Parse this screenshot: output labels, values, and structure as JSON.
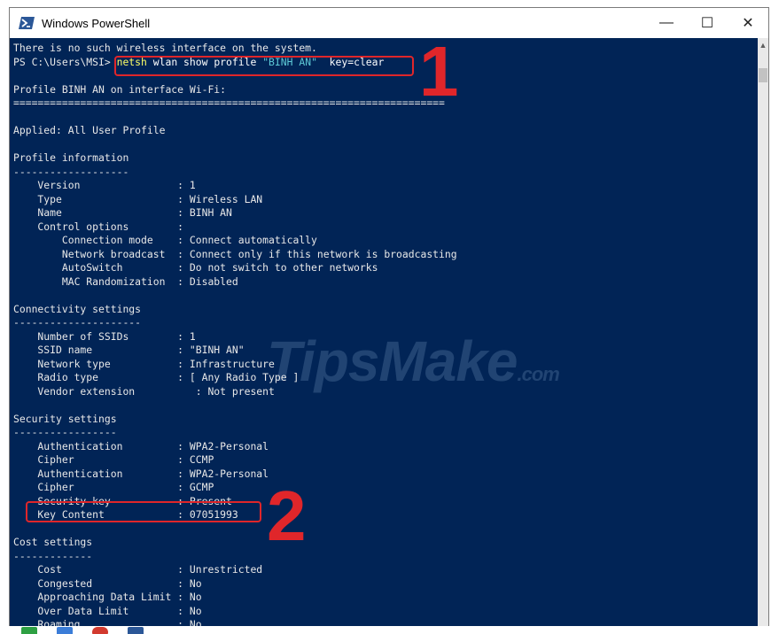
{
  "window": {
    "title": "Windows PowerShell",
    "controls": {
      "minimize": "—",
      "maximize": "☐",
      "close": "✕"
    }
  },
  "console": {
    "line1": "There is no such wireless interface on the system.",
    "prompt": {
      "ps": "PS C:\\Users\\MSI> ",
      "command": "netsh",
      "args": " wlan show profile ",
      "name_arg": "\"BINH AN\"",
      "key_arg": "  key=clear"
    },
    "lines": [
      "",
      "Profile BINH AN on interface Wi-Fi:",
      "=======================================================================",
      "",
      "Applied: All User Profile",
      "",
      "Profile information",
      "-------------------",
      "    Version                : 1",
      "    Type                   : Wireless LAN",
      "    Name                   : BINH AN",
      "    Control options        :",
      "        Connection mode    : Connect automatically",
      "        Network broadcast  : Connect only if this network is broadcasting",
      "        AutoSwitch         : Do not switch to other networks",
      "        MAC Randomization  : Disabled",
      "",
      "Connectivity settings",
      "---------------------",
      "    Number of SSIDs        : 1",
      "    SSID name              : \"BINH AN\"",
      "    Network type           : Infrastructure",
      "    Radio type             : [ Any Radio Type ]",
      "    Vendor extension          : Not present",
      "",
      "Security settings",
      "-----------------",
      "    Authentication         : WPA2-Personal",
      "    Cipher                 : CCMP",
      "    Authentication         : WPA2-Personal",
      "    Cipher                 : GCMP",
      "    Security key           : Present",
      "    Key Content            : 07051993",
      "",
      "Cost settings",
      "-------------",
      "    Cost                   : Unrestricted",
      "    Congested              : No",
      "    Approaching Data Limit : No",
      "    Over Data Limit        : No",
      "    Roaming                : No"
    ]
  },
  "annotations": {
    "marker1": "1",
    "marker2": "2",
    "highlight_color": "#e0262a"
  },
  "watermark": {
    "main": "TipsMake",
    "suffix": ".com"
  },
  "colors": {
    "console_bg": "#012456",
    "console_text": "#e8e8e8",
    "command": "#ffff66",
    "string": "#5ec9d6"
  }
}
